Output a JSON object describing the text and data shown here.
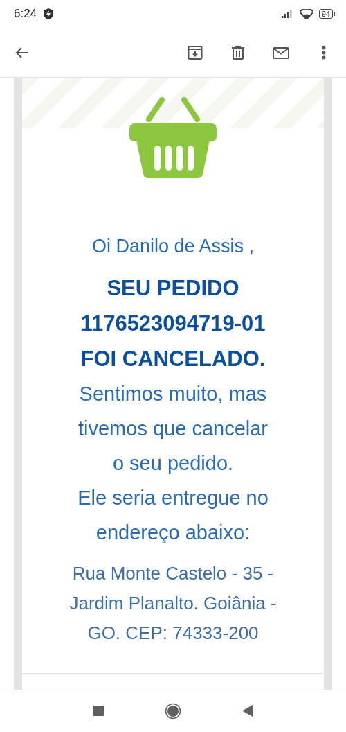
{
  "status_bar": {
    "time": "6:24",
    "battery": "94"
  },
  "email": {
    "greeting": "Oi Danilo de Assis ,",
    "headline_lines": [
      "SEU PEDIDO",
      "1176523094719-01",
      "FOI CANCELADO."
    ],
    "message_lines": [
      "Sentimos muito, mas",
      "tivemos que cancelar",
      "o seu pedido.",
      "Ele seria entregue no",
      "endereço abaixo:"
    ],
    "address_lines": [
      "Rua Monte Castelo - 35 -",
      "Jardim Planalto. Goiânia -",
      "GO. CEP: 74333-200"
    ]
  }
}
